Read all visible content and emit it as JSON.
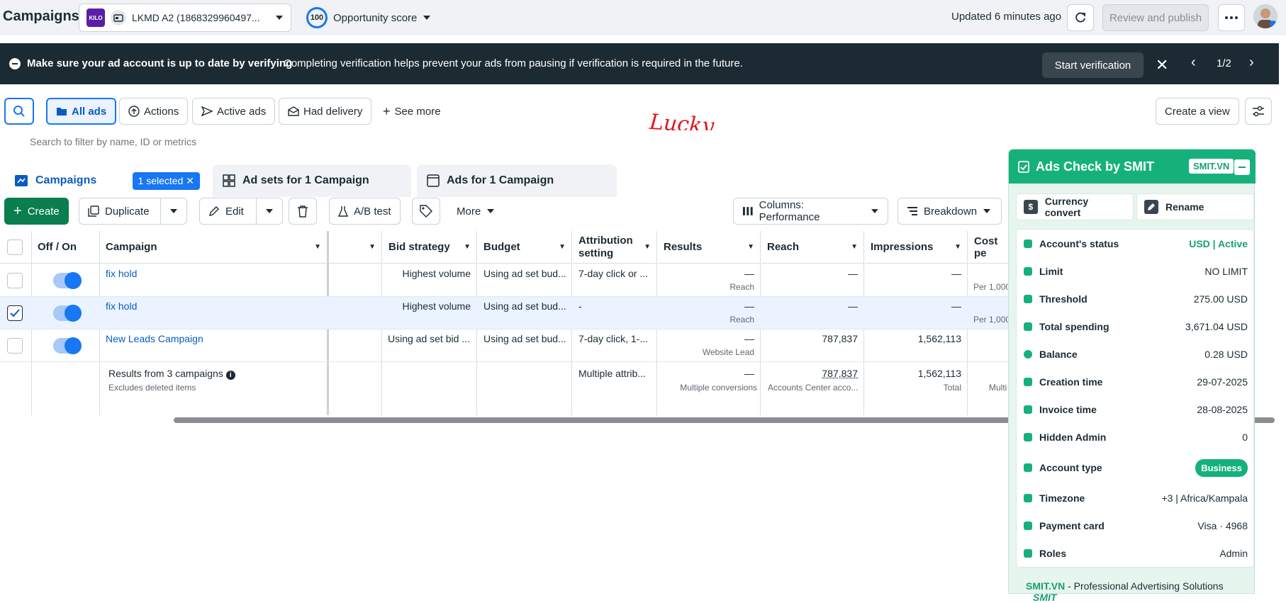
{
  "header": {
    "title": "Campaigns",
    "account_logo": "KILO",
    "account_name": "LKMD A2 (1868329960497...",
    "score": "100",
    "opportunity_label": "Opportunity score",
    "updated": "Updated 6 minutes ago",
    "review_publish": "Review and publish"
  },
  "banner": {
    "title": "Make sure your ad account is up to date by verifying",
    "text": "Completing verification helps prevent your ads from pausing if verification is required in the future.",
    "button": "Start verification",
    "page": "1/2"
  },
  "filters": {
    "all_ads": "All ads",
    "actions": "Actions",
    "active_ads": "Active ads",
    "had_delivery": "Had delivery",
    "see_more": "See more",
    "create_view": "Create a view",
    "search_placeholder": "Search to filter by name, ID or metrics"
  },
  "annotation": "Lucky",
  "tabs": {
    "campaigns": "Campaigns",
    "selected": "1 selected",
    "adsets": "Ad sets for 1 Campaign",
    "ads": "Ads for 1 Campaign"
  },
  "toolbar": {
    "create": "Create",
    "duplicate": "Duplicate",
    "edit": "Edit",
    "ab_test": "A/B test",
    "more": "More",
    "columns": "Columns: Performance",
    "breakdown": "Breakdown"
  },
  "table": {
    "headers": {
      "off_on": "Off / On",
      "campaign": "Campaign",
      "bid_strategy": "Bid strategy",
      "budget": "Budget",
      "attribution_1": "Attribution",
      "attribution_2": "setting",
      "results": "Results",
      "reach": "Reach",
      "impressions": "Impressions",
      "cost_per": "Cost pe"
    },
    "rows": [
      {
        "name": "fix hold",
        "bid": "Highest volume",
        "budget": "Using ad set bud...",
        "attribution": "7-day click or ...",
        "results": "—",
        "results_sub": "Reach",
        "reach": "—",
        "impressions": "—",
        "cost_sub": "Per 1,000"
      },
      {
        "name": "fix hold",
        "bid": "Highest volume",
        "budget": "Using ad set bud...",
        "attribution": "-",
        "results": "—",
        "results_sub": "Reach",
        "reach": "—",
        "impressions": "—",
        "cost_sub": "Per 1,000"
      },
      {
        "name": "New Leads Campaign",
        "bid": "Using ad set bid ...",
        "budget": "Using ad set bud...",
        "attribution": "7-day click, 1-...",
        "results": "—",
        "results_sub": "Website Lead",
        "reach": "787,837",
        "impressions": "1,562,113",
        "cost_sub": ""
      }
    ],
    "summary": {
      "title": "Results from 3 campaigns",
      "sub": "Excludes deleted items",
      "attribution": "Multiple attrib...",
      "results": "—",
      "results_sub": "Multiple conversions",
      "reach": "787,837",
      "reach_sub": "Accounts Center acco...",
      "impressions": "1,562,113",
      "impressions_sub": "Total",
      "cost_sub": "Multi"
    }
  },
  "smit": {
    "title": "Ads Check by SMIT",
    "badge": "SMIT.VN",
    "currency_convert": "Currency convert",
    "rename": "Rename",
    "rows": [
      {
        "label": "Account's status",
        "value": "USD | Active"
      },
      {
        "label": "Limit",
        "value": "NO LIMIT"
      },
      {
        "label": "Threshold",
        "value": "275.00 USD"
      },
      {
        "label": "Total spending",
        "value": "3,671.04 USD"
      },
      {
        "label": "Balance",
        "value": "0.28 USD"
      },
      {
        "label": "Creation time",
        "value": "29-07-2025"
      },
      {
        "label": "Invoice time",
        "value": "28-08-2025"
      },
      {
        "label": "Hidden Admin",
        "value": "0"
      },
      {
        "label": "Account type",
        "value": "Business"
      },
      {
        "label": "Timezone",
        "value": "+3 | Africa/Kampala"
      },
      {
        "label": "Payment card",
        "value": "Visa · 4968"
      },
      {
        "label": "Roles",
        "value": "Admin"
      }
    ],
    "footer_brand": "SMIT.VN",
    "footer_text": " - Professional Advertising Solutions",
    "footer_logo": "SMIT"
  },
  "colors": {
    "accent": "#1877f2",
    "create": "#0a7e4e",
    "smit": "#16b17a",
    "banner": "#1c2b33"
  }
}
